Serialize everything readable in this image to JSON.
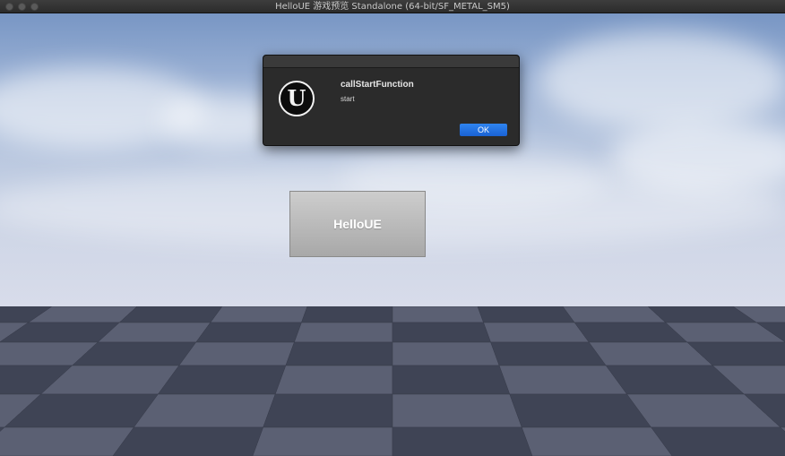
{
  "window": {
    "title": "HelloUE 游戏预览 Standalone (64-bit/SF_METAL_SM5)"
  },
  "dialog": {
    "logo_letter": "U",
    "title": "callStartFunction",
    "message": "start",
    "ok_label": "OK",
    "colors": {
      "button": "#1a62d4",
      "background": "#2b2b2b"
    }
  },
  "game_ui": {
    "hello_button_label": "HelloUE"
  },
  "colors": {
    "sky_top": "#7896c4",
    "floor_dark": "#3f4455",
    "floor_light": "#5b6073"
  }
}
